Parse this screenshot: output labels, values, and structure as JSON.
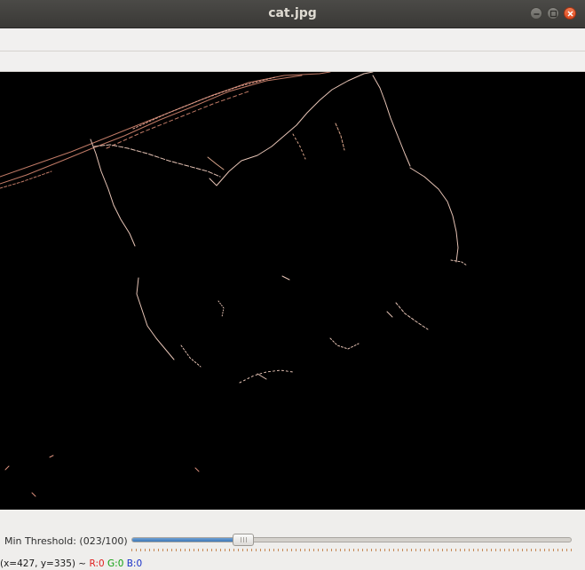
{
  "window": {
    "title": "cat.jpg"
  },
  "titlebar_buttons": {
    "minimize_icon": "minimize-icon",
    "maximize_icon": "maximize-icon",
    "close_icon": "close-icon"
  },
  "image": {
    "description_icon": "edge-detected-cat-image"
  },
  "trackbar": {
    "label": "Min Threshold: (023/100)",
    "value": 23,
    "max": 100
  },
  "status": {
    "coords": "(x=427, y=335) ~",
    "r": "R:0",
    "g": "G:0",
    "b": "B:0"
  },
  "colors": {
    "r": "#e02020",
    "g": "#10a010",
    "b": "#1830c8",
    "edge": "#d9a48a"
  }
}
